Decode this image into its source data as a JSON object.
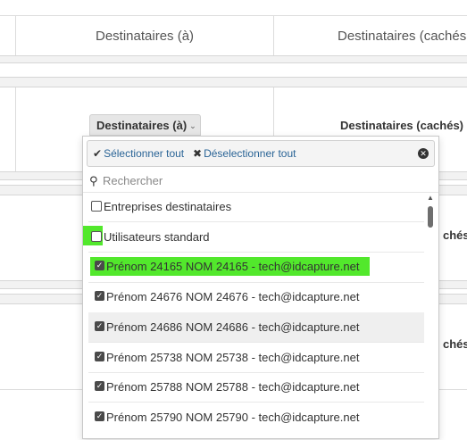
{
  "table": {
    "col_to_header": "Destinataires (à)",
    "col_bcc_header": "Destinataires (cachés",
    "bcc_button_label": "Destinataires (cachés)",
    "partial_label_1": "chés)",
    "partial_label_2": "chés)"
  },
  "dropdown": {
    "button_label": "Destinataires (à)",
    "select_all": "Sélectionner tout",
    "deselect_all": "Déselectionner tout",
    "search_placeholder": "Rechercher",
    "groups": [
      {
        "label": "Entreprises destinataires",
        "checked": false
      },
      {
        "label": "Utilisateurs standard",
        "checked": false
      }
    ],
    "users": [
      {
        "label": "Prénom 24165 NOM 24165 - tech@idcapture.net",
        "checked": true
      },
      {
        "label": "Prénom 24676 NOM 24676 - tech@idcapture.net",
        "checked": true
      },
      {
        "label": "Prénom 24686 NOM 24686 - tech@idcapture.net",
        "checked": true
      },
      {
        "label": "Prénom 25738 NOM 25738 - tech@idcapture.net",
        "checked": true
      },
      {
        "label": "Prénom 25788 NOM 25788 - tech@idcapture.net",
        "checked": true
      },
      {
        "label": "Prénom 25790 NOM 25790 - tech@idcapture.net",
        "checked": true
      }
    ]
  },
  "colors": {
    "highlight": "#52e82c",
    "link": "#2a6496",
    "hover_row": "#efefef"
  }
}
